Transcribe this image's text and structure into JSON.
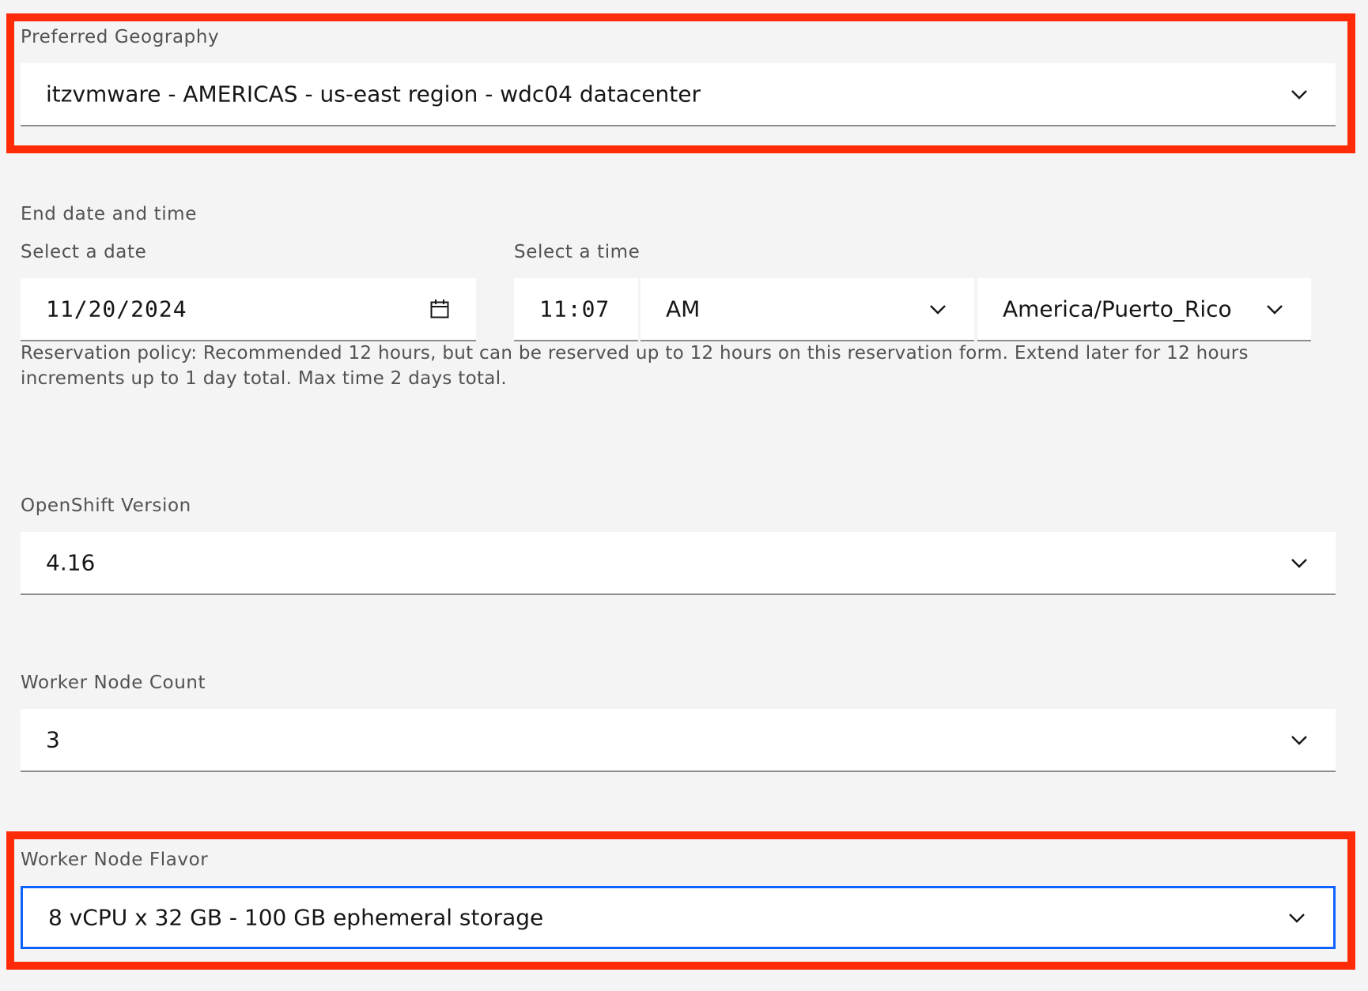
{
  "geography": {
    "label": "Preferred Geography",
    "value": "itzvmware - AMERICAS - us-east region - wdc04 datacenter",
    "icon": "chevron-down-icon"
  },
  "end_datetime": {
    "label": "End date and time",
    "date_label": "Select a date",
    "date_value": "11/20/2024",
    "date_icon": "calendar-icon",
    "time_label": "Select a time",
    "time_value": "11:07",
    "ampm_value": "AM",
    "timezone_value": "America/Puerto_Rico",
    "helper_text": "Reservation policy: Recommended 12 hours, but can be reserved up to 12 hours on this reservation form. Extend later for 12 hours increments up to 1 day total. Max time 2 days total."
  },
  "openshift_version": {
    "label": "OpenShift Version",
    "value": "4.16"
  },
  "worker_node_count": {
    "label": "Worker Node Count",
    "value": "3"
  },
  "worker_node_flavor": {
    "label": "Worker Node Flavor",
    "value": "8 vCPU x 32 GB - 100 GB ephemeral storage"
  },
  "colors": {
    "background": "#f4f4f4",
    "field_background": "#ffffff",
    "highlight_border": "#ff2a08",
    "focus_border": "#0f62fe",
    "label_text": "#525252",
    "value_text": "#161616"
  }
}
